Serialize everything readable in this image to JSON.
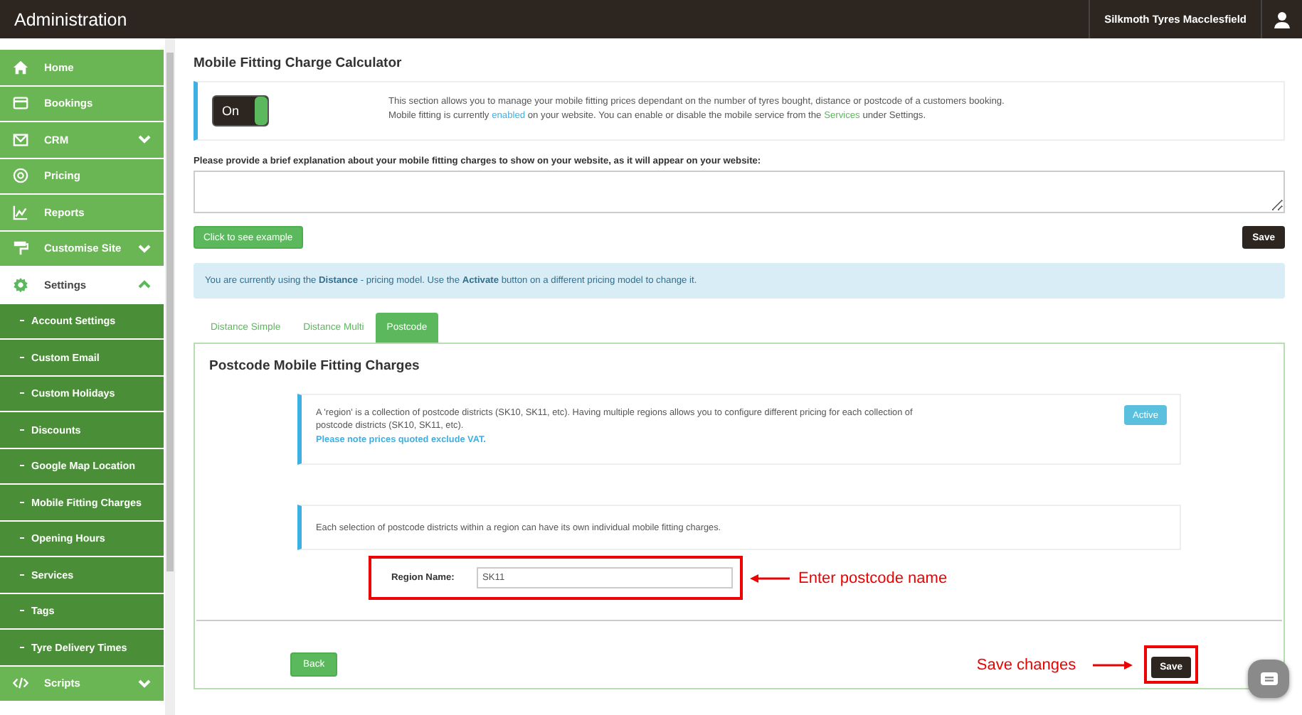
{
  "header": {
    "title": "Administration",
    "account": "Silkmoth Tyres Macclesfield"
  },
  "sidebar": {
    "items": [
      {
        "label": "Home",
        "selected": false
      },
      {
        "label": "Bookings",
        "selected": false
      },
      {
        "label": "CRM",
        "selected": false,
        "expanded": false
      },
      {
        "label": "Pricing",
        "selected": false
      },
      {
        "label": "Reports",
        "selected": false
      },
      {
        "label": "Customise Site",
        "selected": false,
        "expanded": false
      },
      {
        "label": "Settings",
        "selected": true,
        "expanded": true,
        "children": [
          {
            "label": "Account Settings",
            "selected": false
          },
          {
            "label": "Custom Email",
            "selected": false
          },
          {
            "label": "Custom Holidays",
            "selected": false
          },
          {
            "label": "Discounts",
            "selected": false
          },
          {
            "label": "Google Map Location",
            "selected": false
          },
          {
            "label": "Mobile Fitting Charges",
            "selected": false
          },
          {
            "label": "Opening Hours",
            "selected": false
          },
          {
            "label": "Services",
            "selected": false
          },
          {
            "label": "Tags",
            "selected": false
          },
          {
            "label": "Tyre Delivery Times",
            "selected": false
          }
        ]
      },
      {
        "label": "Scripts",
        "selected": false,
        "expanded": false
      }
    ]
  },
  "page": {
    "title": "Mobile Fitting Charge Calculator",
    "toggle": {
      "label": "On",
      "on": true
    },
    "intro": [
      [
        {
          "kind": "plain",
          "text": "This section allows you to manage your mobile fitting prices dependant on the number of tyres bought, distance or postcode of a customers booking."
        }
      ],
      [
        {
          "kind": "plain",
          "text": "Mobile fitting is currently "
        },
        {
          "kind": "status",
          "text": "enabled"
        },
        {
          "kind": "plain",
          "text": " on your website. You can enable or disable the mobile service from the "
        },
        {
          "kind": "link",
          "text": "Services"
        },
        {
          "kind": "plain",
          "text": " under Settings."
        }
      ]
    ],
    "explanation_label": "Please provide a brief explanation about your mobile fitting charges to show on your website, as it will appear on your website:",
    "example_button": "Click to see example",
    "save_button": "Save",
    "model_notice": "You are currently using the **Distance** - pricing model. Use the **Activate** button on a different pricing model to change it.",
    "tabs": [
      {
        "label": "Distance Simple",
        "selected": false
      },
      {
        "label": "Distance Multi",
        "selected": false
      },
      {
        "label": "Postcode",
        "selected": true
      }
    ],
    "panel": {
      "title": "Postcode Mobile Fitting Charges",
      "region_info": "A 'region' is a collection of postcode districts (SK10, SK11, etc). Having multiple regions allows you to configure different pricing for each collection of postcode districts (SK10, SK11, etc).",
      "vat_note": "Please note prices quoted exclude VAT.",
      "status_badge": "Active",
      "selection_info": "Each selection of postcode districts within a region can have its own individual mobile fitting charges.",
      "region_label": "Region Name:",
      "region_value": "SK11",
      "back_button": "Back",
      "save_button": "Save"
    }
  },
  "annotations": {
    "region_note": "Enter postcode name",
    "save_note": "Save changes"
  }
}
